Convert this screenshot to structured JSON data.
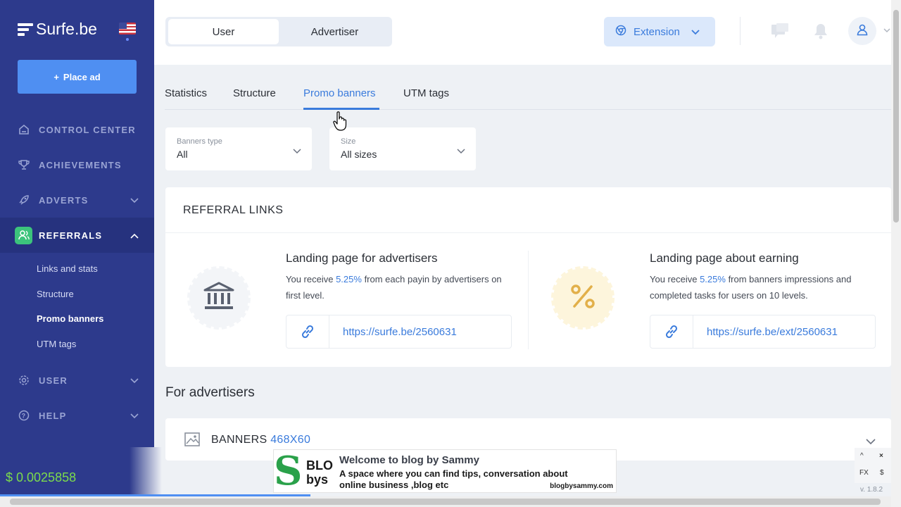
{
  "sidebar": {
    "logo_text": "Surfe.be",
    "place_ad_label": "Place ad",
    "nav": {
      "control_center": "CONTROL CENTER",
      "achievements": "ACHIEVEMENTS",
      "adverts": "ADVERTS",
      "referrals": "REFERRALS",
      "user": "USER",
      "help": "HELP"
    },
    "referrals_sub": [
      "Links and stats",
      "Structure",
      "Promo banners",
      "UTM tags"
    ]
  },
  "header": {
    "toggle": [
      "User",
      "Advertiser"
    ],
    "extension_label": "Extension"
  },
  "tabs": [
    "Statistics",
    "Structure",
    "Promo banners",
    "UTM tags"
  ],
  "filters": {
    "banners_type": {
      "label": "Banners type",
      "value": "All"
    },
    "size": {
      "label": "Size",
      "value": "All sizes"
    }
  },
  "referral_links": {
    "title": "REFERRAL LINKS",
    "advertisers": {
      "title": "Landing page for advertisers",
      "desc_pre": "You receive ",
      "percent": "5.25%",
      "desc_post": " from each payin by advertisers on first level.",
      "link": "https://surfe.be/2560631"
    },
    "earning": {
      "title": "Landing page about earning",
      "desc_pre": "You receive ",
      "percent": "5.25%",
      "desc_post": " from banners impressions and completed tasks for users on 10 levels.",
      "link": "https://surfe.be/ext/2560631"
    }
  },
  "for_advertisers": {
    "title": "For advertisers",
    "banner_label": "BANNERS",
    "banner_size": "468X60"
  },
  "overlay": {
    "balance": "$ 0.0025858",
    "ad_letter": "S",
    "ad_logo_line1": "BLO",
    "ad_logo_line2": "bys",
    "ad_headline": "Welcome to blog by Sammy",
    "ad_subline": "A space where you can find tips, conversation about online business ,blog etc",
    "ad_url": "blogbysammy.com",
    "panel_fx": "FX",
    "panel_dollar": "$",
    "panel_close": "×",
    "panel_up": "^",
    "version": "v. 1.8.2"
  },
  "colors": {
    "sidebar": "#2d3a8c",
    "accent": "#3a7bdc",
    "referrals_icon": "#3cc47c",
    "balance": "#7cdc4c"
  }
}
